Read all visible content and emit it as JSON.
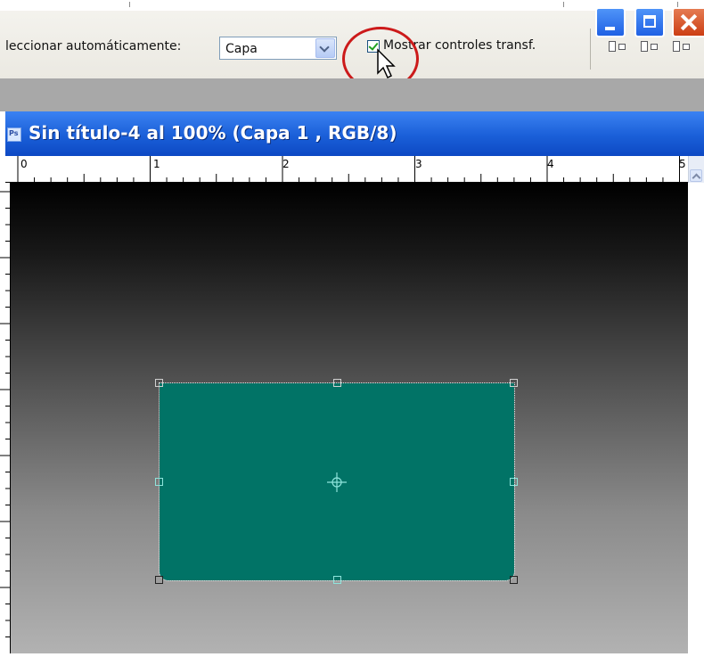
{
  "options_bar": {
    "auto_select_label": "leccionar automáticamente:",
    "auto_select_value": "Capa",
    "show_transform_label": "Mostrar controles transf.",
    "show_transform_checked": true
  },
  "document": {
    "title": "Sin título-4 al 100% (Capa 1 , RGB/8)",
    "ruler_numbers": [
      "0",
      "1",
      "2",
      "3",
      "4",
      "5"
    ]
  },
  "colors": {
    "shape_fill": "#017366",
    "annotation_circle": "#cc1a1a",
    "titlebar": "#1a5fd8"
  }
}
